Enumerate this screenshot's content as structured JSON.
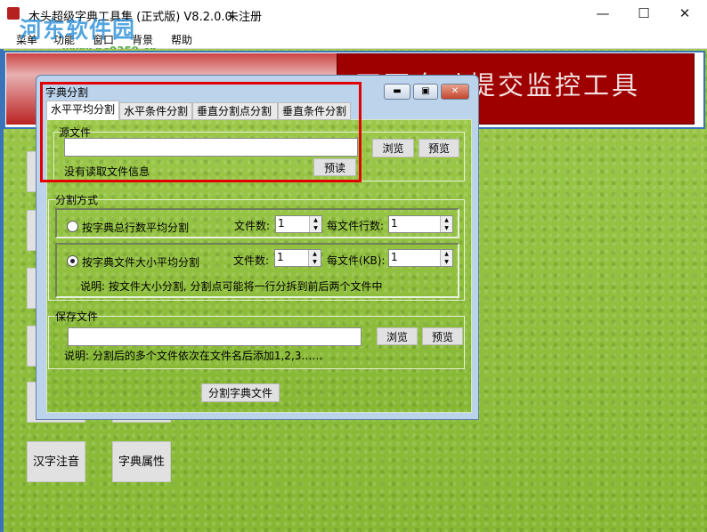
{
  "window": {
    "title": "木头超级字典工具集 (正式版) V8.2.0.0",
    "registration": "未注册",
    "minimize": "—",
    "maximize": "☐",
    "close": "✕"
  },
  "watermark": {
    "name": "河东软件园",
    "url": "www.pc0359.cn"
  },
  "menu": [
    "菜单",
    "功能",
    "窗口",
    "背景",
    "帮助"
  ],
  "banner": {
    "text": "网页自动提交监控工具"
  },
  "side_buttons": {
    "pinyin": "汉字注音",
    "properties": "字典属性"
  },
  "dialog": {
    "title": "字典分割",
    "tabs": [
      "水平平均分割",
      "水平条件分割",
      "垂直分割点分割",
      "垂直条件分割"
    ],
    "source": {
      "legend": "源文件",
      "path": "",
      "browse": "浏览",
      "preview": "预览",
      "preread": "预读",
      "status": "没有读取文件信息"
    },
    "mode": {
      "legend": "分割方式",
      "option1": {
        "label": "按字典总行数平均分割",
        "selected": false,
        "files_label": "文件数:",
        "files": "1",
        "per_label": "每文件行数:",
        "per": "1"
      },
      "option2": {
        "label": "按字典文件大小平均分割",
        "selected": true,
        "files_label": "文件数:",
        "files": "1",
        "per_label": "每文件(KB):",
        "per": "1",
        "note": "说明: 按文件大小分割, 分割点可能将一行分拆到前后两个文件中"
      }
    },
    "save": {
      "legend": "保存文件",
      "path": "",
      "browse": "浏览",
      "preview": "预览",
      "note": "说明: 分割后的多个文件依次在文件名后添加1,2,3……"
    },
    "split_button": "分割字典文件"
  }
}
